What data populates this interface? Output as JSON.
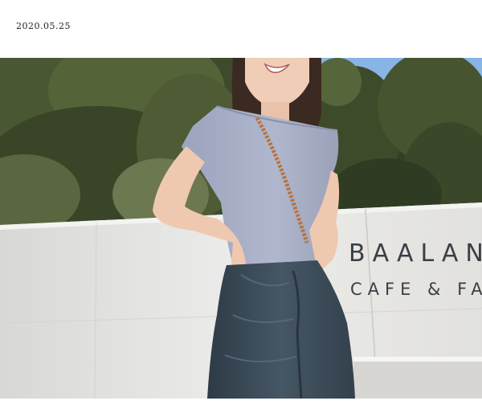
{
  "post": {
    "date": "2020.05.25"
  },
  "photo": {
    "sign": {
      "line1": "BAALAN",
      "line2": "CAFE & FA"
    },
    "colors": {
      "sky": "#9ec4ea",
      "foliage": "#3d4a2e",
      "wall": "#e6e6e2",
      "top": "#a9b0c8",
      "skirt": "#3b4a57",
      "skin": "#ecc7b0",
      "hair": "#3a2a22",
      "beads": "#b9713c"
    }
  }
}
